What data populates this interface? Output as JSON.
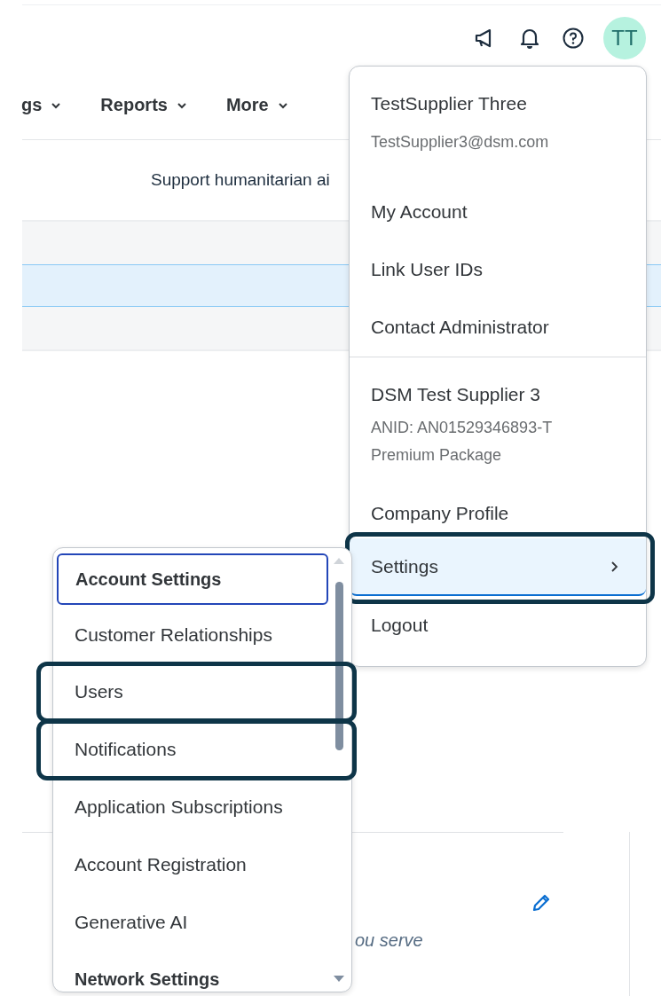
{
  "header": {
    "avatar": "TT"
  },
  "nav": {
    "tabs": [
      {
        "label": "gs"
      },
      {
        "label": "Reports"
      },
      {
        "label": "More"
      }
    ]
  },
  "banner": {
    "text": "Support humanitarian ai"
  },
  "list_band": {
    "rows": [
      {
        "selected": false
      },
      {
        "selected": true
      },
      {
        "selected": false
      }
    ]
  },
  "content": {
    "text": "ou serve"
  },
  "profile_menu": {
    "sections": [
      {
        "header": "TestSupplier Three",
        "details": [
          "TestSupplier3@dsm.com"
        ],
        "items": [
          {
            "label": "My Account",
            "selected": false,
            "highlighted": false,
            "submenu": false
          },
          {
            "label": "Link User IDs",
            "selected": false,
            "highlighted": false,
            "submenu": false
          },
          {
            "label": "Contact Administrator",
            "selected": false,
            "highlighted": false,
            "submenu": false
          }
        ]
      },
      {
        "header": "DSM Test Supplier 3",
        "details": [
          "ANID: AN01529346893-T",
          "Premium Package"
        ],
        "items": [
          {
            "label": "Company Profile",
            "selected": false,
            "highlighted": false,
            "submenu": false
          },
          {
            "label": "Settings",
            "selected": true,
            "highlighted": true,
            "submenu": true
          },
          {
            "label": "Logout",
            "selected": false,
            "highlighted": false,
            "submenu": false
          }
        ]
      }
    ]
  },
  "settings_menu": {
    "items": [
      {
        "label": "Account Settings",
        "kind": "group",
        "selected": true,
        "highlighted": false
      },
      {
        "label": "Customer Relationships",
        "kind": "item",
        "selected": false,
        "highlighted": false
      },
      {
        "label": "Users",
        "kind": "item",
        "selected": false,
        "highlighted": true
      },
      {
        "label": "Notifications",
        "kind": "item",
        "selected": false,
        "highlighted": true
      },
      {
        "label": "Application Subscriptions",
        "kind": "item",
        "selected": false,
        "highlighted": false
      },
      {
        "label": "Account Registration",
        "kind": "item",
        "selected": false,
        "highlighted": false
      },
      {
        "label": "Generative AI",
        "kind": "item",
        "selected": false,
        "highlighted": false
      },
      {
        "label": "Network Settings",
        "kind": "group",
        "selected": false,
        "highlighted": false
      }
    ]
  }
}
